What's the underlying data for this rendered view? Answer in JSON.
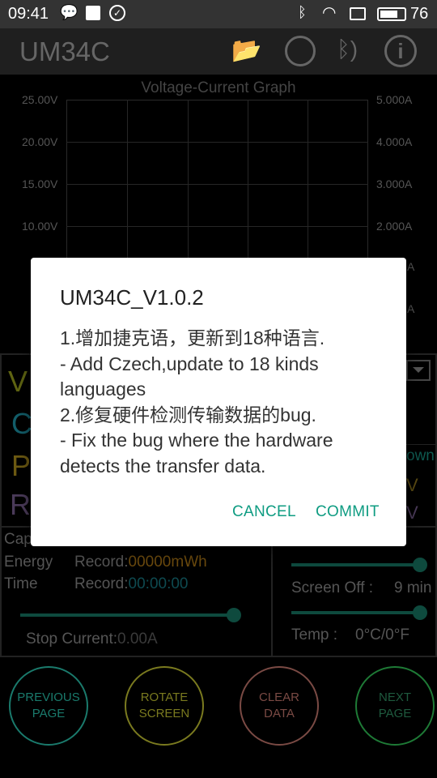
{
  "status_bar": {
    "time": "09:41",
    "battery": "76",
    "icons": [
      "chat-icon",
      "mail-icon",
      "check-circle-icon",
      "bluetooth-icon",
      "wifi-icon",
      "sim-icon",
      "battery-icon"
    ]
  },
  "app_bar": {
    "title": "UM34C",
    "icons": [
      "folder-open-icon",
      "globe-icon",
      "bluetooth-signal-icon",
      "info-icon"
    ]
  },
  "graph": {
    "title": "Voltage-Current Graph",
    "left_ticks": [
      "25.00V",
      "20.00V",
      "15.00V",
      "10.00V"
    ],
    "right_ticks": [
      "5.000A",
      "4.000A",
      "3.000A",
      "2.000A",
      "A",
      "A"
    ]
  },
  "readings": {
    "labels": [
      "V",
      "C",
      "P",
      "R"
    ],
    "right_fragments": [
      "own",
      "V",
      "V"
    ],
    "colors": {
      "voltage": "#5f6412",
      "current": "#135e6a",
      "power": "#6d5a12",
      "resistance": "#4b3b5a"
    }
  },
  "record": {
    "capacity_label": "Cap",
    "energy_label": "Energy",
    "energy_record_label": "Record:",
    "energy_value": "00000mWh",
    "time_label": "Time",
    "time_record_label": "Record:",
    "time_value": "00:00:00",
    "stop_current_label": "Stop Current:",
    "stop_current_value": "0.00A",
    "stop_slider_percent": 100
  },
  "settings": {
    "brightness_slider_percent": 100,
    "screen_off_label": "Screen Off :",
    "screen_off_value": "9 min",
    "screen_off_slider_percent": 100,
    "temp_label": "Temp :",
    "temp_value": "0°C/0°F"
  },
  "buttons": [
    {
      "line1": "PREVIOUS",
      "line2": "PAGE",
      "color": "#1a7a6c"
    },
    {
      "line1": "ROTATE",
      "line2": "SCREEN",
      "color": "#7a7a1f"
    },
    {
      "line1": "CLEAR",
      "line2": "DATA",
      "color": "#7a4a44"
    },
    {
      "line1": "NEXT",
      "line2": "PAGE",
      "color": "#1e7a36"
    }
  ],
  "dialog": {
    "title": "UM34C_V1.0.2",
    "lines": [
      "1.增加捷克语，更新到18种语言.",
      "- Add Czech,update to 18 kinds languages",
      "2.修复硬件检测传输数据的bug.",
      "- Fix the bug where the hardware detects the transfer data."
    ],
    "cancel": "CANCEL",
    "commit": "COMMIT",
    "accent": "#0f9c82"
  }
}
